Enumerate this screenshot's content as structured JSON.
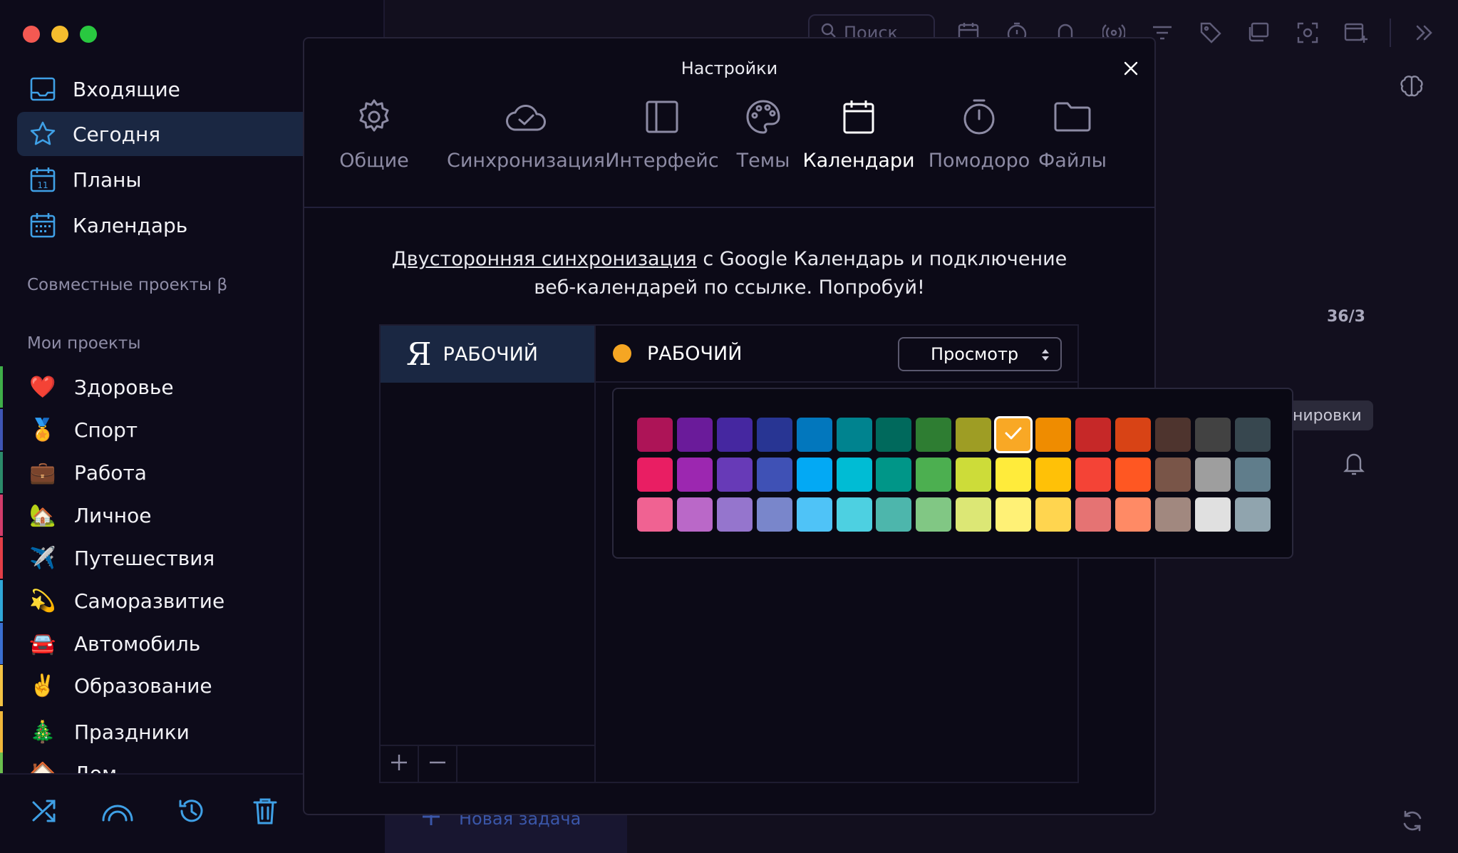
{
  "sidebar": {
    "nav": [
      {
        "label": "Входящие",
        "icon": "inbox-icon",
        "active": false
      },
      {
        "label": "Сегодня",
        "icon": "star-icon",
        "active": true
      },
      {
        "label": "Планы",
        "icon": "calendar-day-icon",
        "active": false
      },
      {
        "label": "Календарь",
        "icon": "calendar-grid-icon",
        "active": false
      }
    ],
    "shared_section": "Совместные проекты β",
    "my_section": "Мои проекты",
    "projects": [
      {
        "label": "Здоровье",
        "emoji": "❤️",
        "color": "#3fae49"
      },
      {
        "label": "Спорт",
        "emoji": "🏅",
        "color": "#3e55b5"
      },
      {
        "label": "Работа",
        "emoji": "💼",
        "color": "#2b8b6a"
      },
      {
        "label": "Личное",
        "emoji": "🏡",
        "color": "#d23c6a"
      },
      {
        "label": "Путешествия",
        "emoji": "✈️",
        "color": "#e23e47"
      },
      {
        "label": "Саморазвитие",
        "emoji": "💫",
        "color": "#2fa7d8"
      },
      {
        "label": "Автомобиль",
        "emoji": "🚘",
        "color": "#3a6fd1"
      },
      {
        "label": "Образование",
        "emoji": "✌️",
        "color": "#f3c343"
      },
      {
        "label": "Праздники",
        "emoji": "🎄",
        "color": "#f0b73a"
      },
      {
        "label": "Дом",
        "emoji": "🏠",
        "color": "#6bbf4e"
      }
    ]
  },
  "toolbar": {
    "search_placeholder": "Поиск"
  },
  "background": {
    "counter": "36/3",
    "chip": "нировки",
    "new_task": "Новая задача"
  },
  "modal": {
    "title": "Настройки",
    "tabs": [
      {
        "label": "Общие",
        "icon": "gear-icon",
        "active": false
      },
      {
        "label": "Синхронизация",
        "icon": "cloud-check-icon",
        "active": false
      },
      {
        "label": "Интерфейс",
        "icon": "layout-icon",
        "active": false
      },
      {
        "label": "Темы",
        "icon": "palette-icon",
        "active": false
      },
      {
        "label": "Календари",
        "icon": "calendar-icon",
        "active": true
      },
      {
        "label": "Помодоро",
        "icon": "timer-icon",
        "active": false
      },
      {
        "label": "Файлы",
        "icon": "folder-icon",
        "active": false
      }
    ],
    "promo_link": "Двусторонняя синхронизация",
    "promo_text1": " с Google Календарь и подключение",
    "promo_text2": "веб-календарей по ссылке. Попробуй!",
    "account": {
      "logo": "Я",
      "name": "РАБОЧИЙ"
    },
    "calendar": {
      "name": "РАБОЧИЙ",
      "color": "#f5a623",
      "permission": "Просмотр"
    },
    "palette": {
      "selected_row": 0,
      "selected_col": 9,
      "rows": [
        [
          "#ad1457",
          "#6a1b9a",
          "#4527a0",
          "#283593",
          "#0277bd",
          "#00838f",
          "#00695c",
          "#2e7d32",
          "#9e9d24",
          "#f9a825",
          "#ef8c00",
          "#c62828",
          "#d84315",
          "#4e342e",
          "#424242",
          "#37474f"
        ],
        [
          "#e91e63",
          "#9c27b0",
          "#673ab7",
          "#3f51b5",
          "#03a9f4",
          "#00bcd4",
          "#009688",
          "#4caf50",
          "#cddc39",
          "#ffeb3b",
          "#ffc107",
          "#f44336",
          "#ff5722",
          "#795548",
          "#9e9e9e",
          "#607d8b"
        ],
        [
          "#f06292",
          "#ba68c8",
          "#9575cd",
          "#7986cb",
          "#4fc3f7",
          "#4dd0e1",
          "#4db6ac",
          "#81c784",
          "#dce775",
          "#fff176",
          "#ffd54f",
          "#e57373",
          "#ff8a65",
          "#a1887f",
          "#e0e0e0",
          "#90a4ae"
        ]
      ]
    }
  }
}
